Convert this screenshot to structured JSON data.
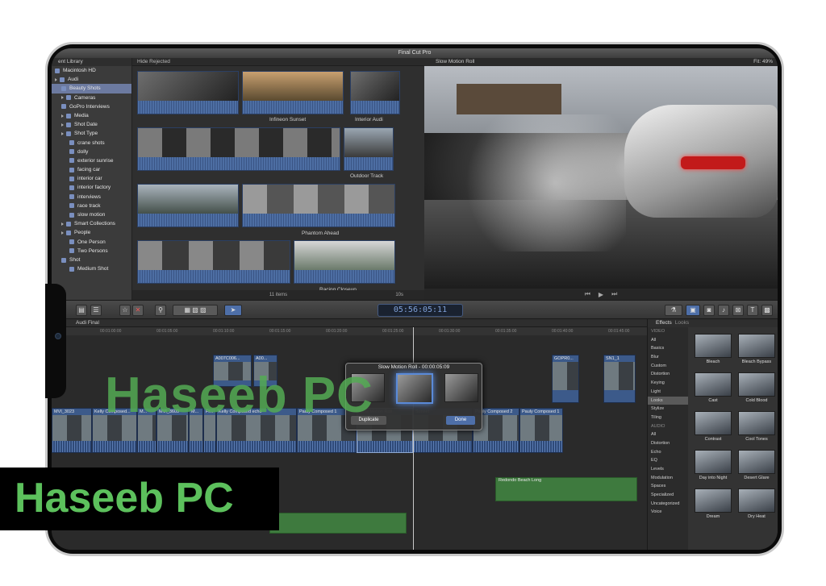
{
  "app": {
    "title": "Final Cut Pro"
  },
  "library": {
    "header": "ent Library",
    "items": [
      {
        "label": "Macintosh HD"
      },
      {
        "label": "Audi"
      },
      {
        "label": "Beauty Shots"
      },
      {
        "label": "Cameras"
      },
      {
        "label": "GoPro Interviews"
      },
      {
        "label": "Media"
      },
      {
        "label": "Shot Date"
      },
      {
        "label": "Shot Type"
      },
      {
        "label": "crane shots"
      },
      {
        "label": "dolly"
      },
      {
        "label": "exterior sunrise"
      },
      {
        "label": "facing car"
      },
      {
        "label": "interior car"
      },
      {
        "label": "interior factory"
      },
      {
        "label": "interviews"
      },
      {
        "label": "race track"
      },
      {
        "label": "slow motion"
      },
      {
        "label": "Smart Collections"
      },
      {
        "label": "People"
      },
      {
        "label": "One Person"
      },
      {
        "label": "Two Persons"
      },
      {
        "label": "Shot"
      },
      {
        "label": "Medium Shot"
      }
    ]
  },
  "browser": {
    "filter": "Hide Rejected",
    "clip_labels": [
      "Infineon Sunset",
      "Interior Audi",
      "Outdoor Track",
      "Phantom Ahead",
      "Racing Closeup"
    ],
    "footer": "11 items",
    "duration": "10s"
  },
  "viewer": {
    "title": "Slow Motion Roll",
    "fit_label": "Fit:",
    "fit_value": "49%"
  },
  "toolbar": {
    "timecode": "05:56:05:11"
  },
  "timeline": {
    "project": "Audi Final",
    "ruler": [
      "00:01:00:00",
      "00:01:05:00",
      "00:01:10:00",
      "00:01:15:00",
      "00:01:20:00",
      "00:01:25:00",
      "00:01:30:00",
      "00:01:35:00",
      "00:01:40:00",
      "00:01:45:00"
    ],
    "connected": [
      "A007C006...",
      "A00...",
      "GOPR0...",
      "SN1_1"
    ],
    "storyline": [
      "MVI_3023",
      "Kelly Composed...",
      "M...",
      "MVI_3609",
      "M...",
      "Fr...",
      "Kelly Composed echo",
      "Pauly Composed 1",
      "Slow Motion Roll",
      "Sunset",
      "Pauly Composed 2",
      "Pauly Composed 1"
    ],
    "audio": "Redondo Beach Long",
    "popup": {
      "title": "Slow Motion Roll - 00:00:05:09",
      "duplicate": "Duplicate",
      "done": "Done"
    }
  },
  "effects": {
    "title": "Effects",
    "subtitle": "Looks",
    "categories": [
      {
        "label": "VIDEO",
        "header": true
      },
      {
        "label": "All"
      },
      {
        "label": "Basics"
      },
      {
        "label": "Blur"
      },
      {
        "label": "Custom"
      },
      {
        "label": "Distortion"
      },
      {
        "label": "Keying"
      },
      {
        "label": "Light"
      },
      {
        "label": "Looks",
        "selected": true
      },
      {
        "label": "Stylize"
      },
      {
        "label": "Tiling"
      },
      {
        "label": "AUDIO",
        "header": true
      },
      {
        "label": "All"
      },
      {
        "label": "Distortion"
      },
      {
        "label": "Echo"
      },
      {
        "label": "EQ"
      },
      {
        "label": "Levels"
      },
      {
        "label": "Modulation"
      },
      {
        "label": "Spaces"
      },
      {
        "label": "Specialized"
      },
      {
        "label": "Uncategorized"
      },
      {
        "label": "Voice"
      }
    ],
    "tiles": [
      "Bleach",
      "Bleach Bypass",
      "Cast",
      "Cold Blood",
      "Contrast",
      "Cool Tones",
      "Day into Night",
      "Desert Glare",
      "Dream",
      "Dry Heat"
    ]
  },
  "watermark": {
    "text": "Haseeb PC"
  },
  "colors": {
    "accent": "#4e6fa8",
    "watermark_green": "#5cc05c",
    "taillight": "#c21a1a"
  }
}
